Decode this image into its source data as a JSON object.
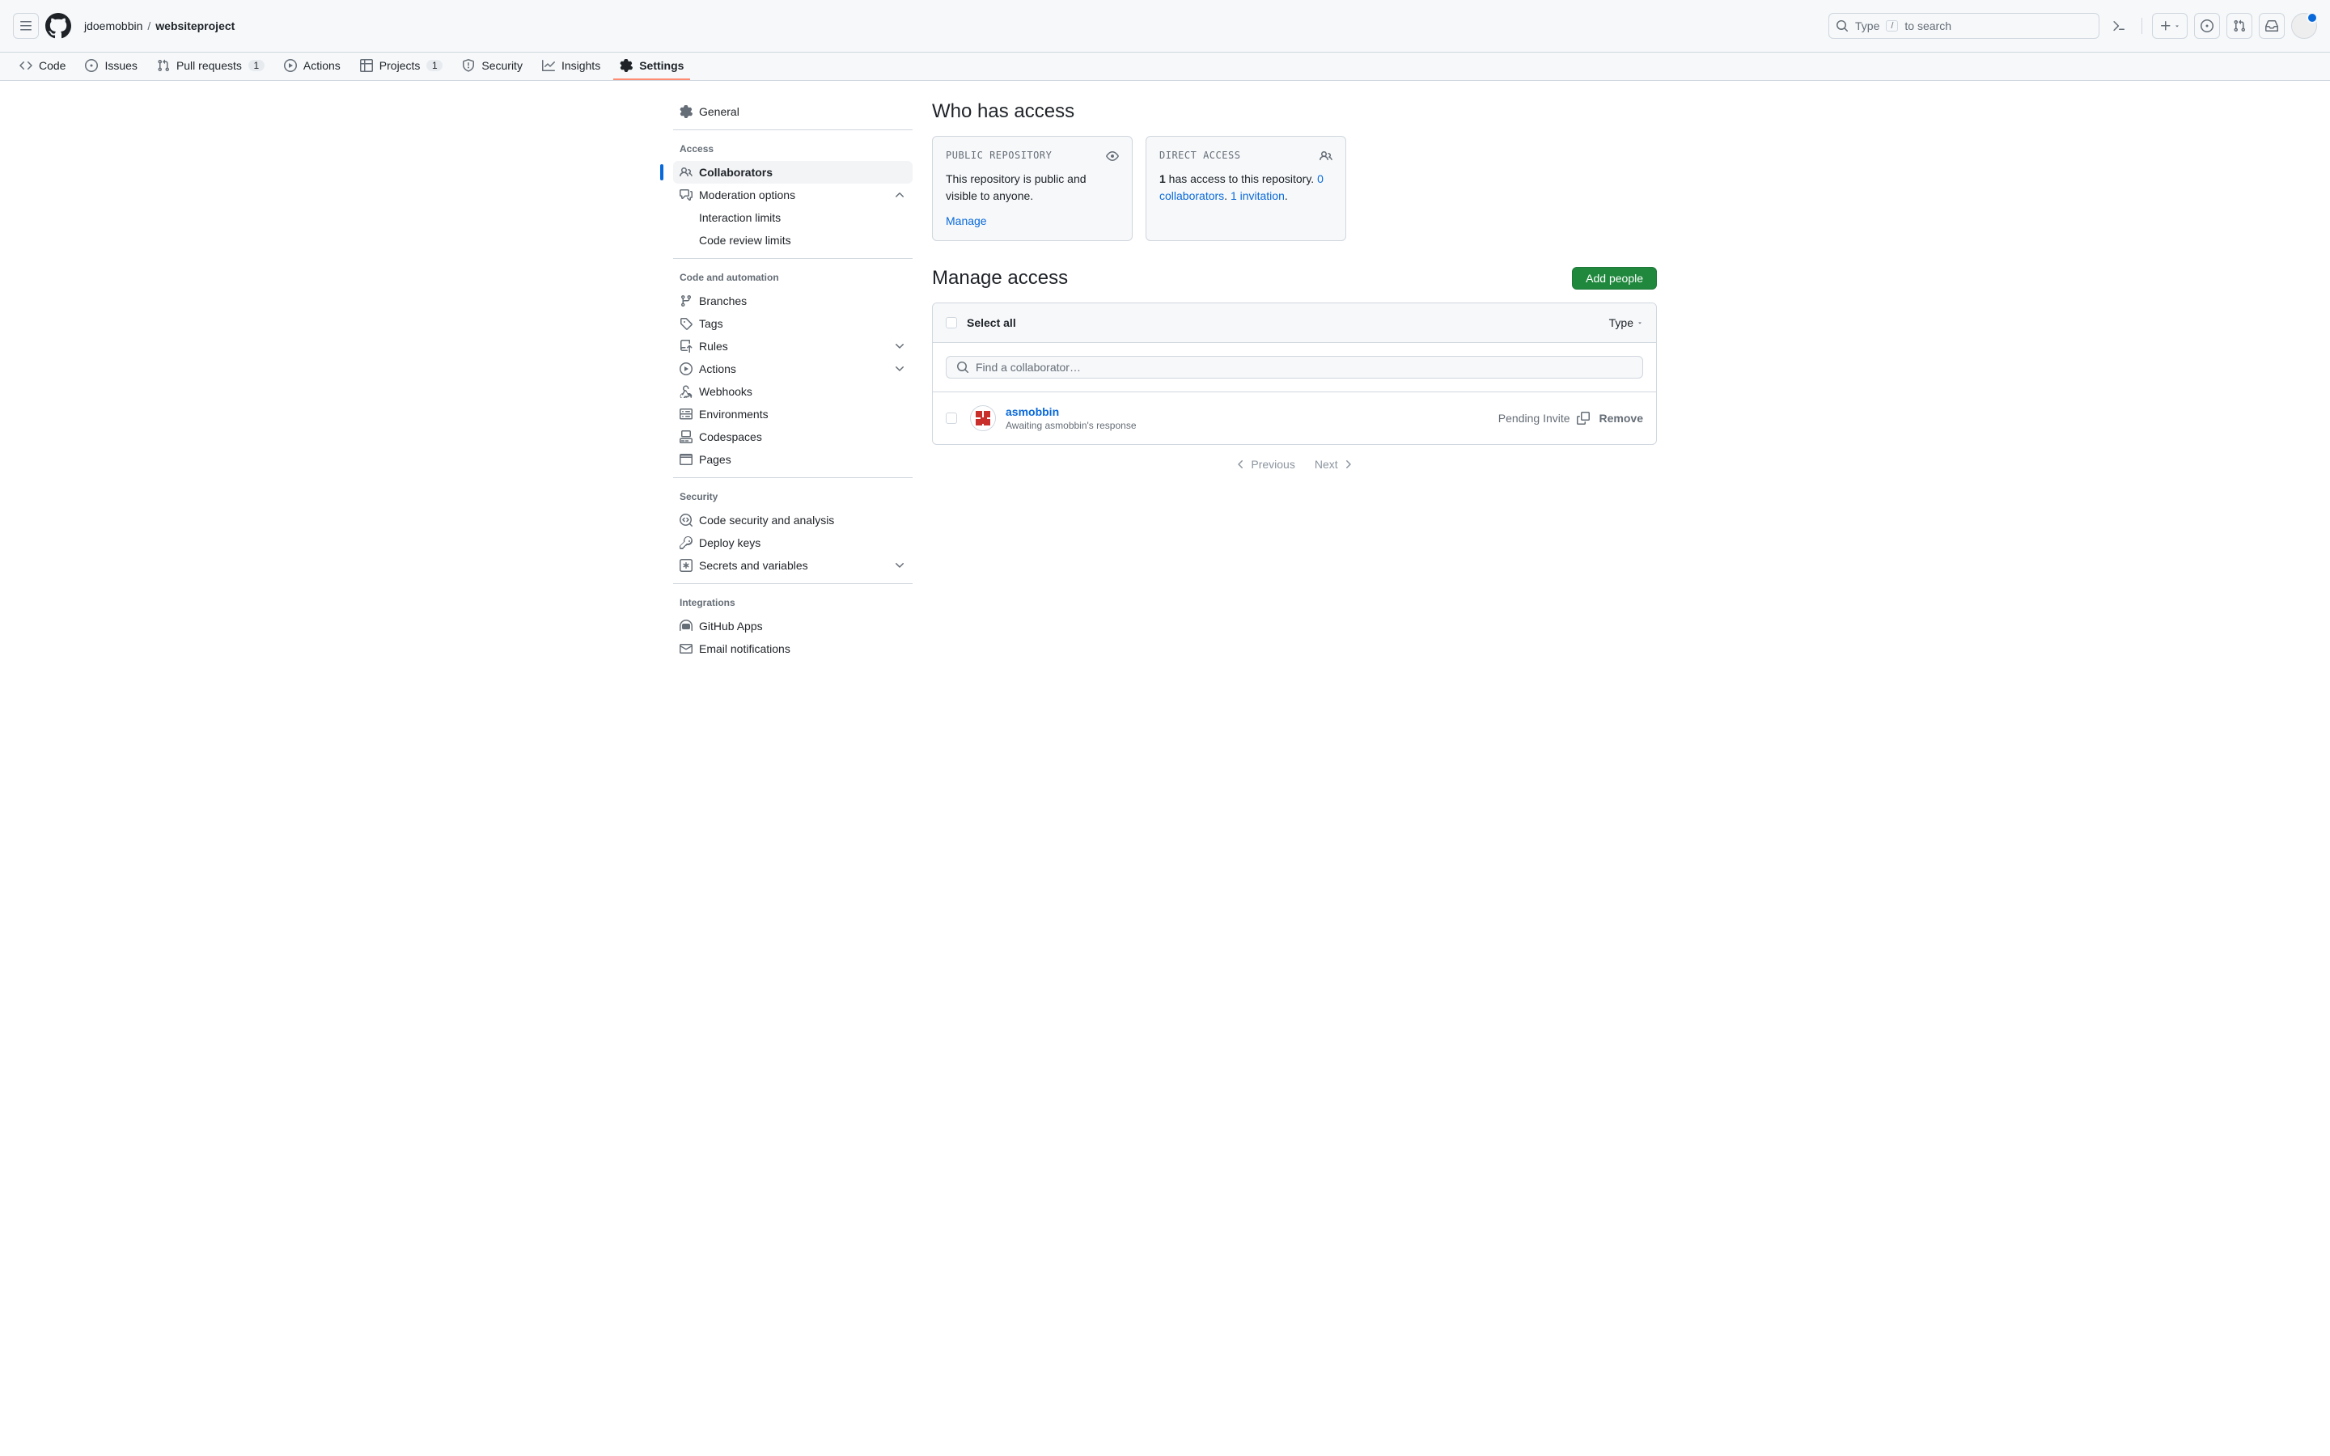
{
  "header": {
    "owner": "jdoemobbin",
    "sep": "/",
    "repo": "websiteproject",
    "search_hint_type": "Type",
    "search_hint_slash": "/",
    "search_hint_rest": "to search"
  },
  "nav": {
    "code": "Code",
    "issues": "Issues",
    "pulls": "Pull requests",
    "pulls_count": "1",
    "actions": "Actions",
    "projects": "Projects",
    "projects_count": "1",
    "security": "Security",
    "insights": "Insights",
    "settings": "Settings"
  },
  "sidebar": {
    "general": "General",
    "access_header": "Access",
    "collaborators": "Collaborators",
    "moderation": "Moderation options",
    "interaction_limits": "Interaction limits",
    "code_review_limits": "Code review limits",
    "code_auto_header": "Code and automation",
    "branches": "Branches",
    "tags": "Tags",
    "rules": "Rules",
    "actions": "Actions",
    "webhooks": "Webhooks",
    "environments": "Environments",
    "codespaces": "Codespaces",
    "pages": "Pages",
    "security_header": "Security",
    "code_security": "Code security and analysis",
    "deploy_keys": "Deploy keys",
    "secrets": "Secrets and variables",
    "integrations_header": "Integrations",
    "github_apps": "GitHub Apps",
    "email_notifications": "Email notifications"
  },
  "main": {
    "who_has_access": "Who has access",
    "public_repo_label": "PUBLIC REPOSITORY",
    "public_repo_text": "This repository is public and visible to anyone.",
    "public_repo_manage": "Manage",
    "direct_access_label": "DIRECT ACCESS",
    "direct_access_count": "1",
    "direct_access_text": " has access to this repository. ",
    "direct_access_collab_link": "0 collaborators",
    "direct_access_period1": ". ",
    "direct_access_invite_link": "1 invitation",
    "direct_access_period2": ".",
    "manage_access": "Manage access",
    "add_people": "Add people",
    "select_all": "Select all",
    "type_filter": "Type",
    "search_placeholder": "Find a collaborator…",
    "collaborator": {
      "username": "asmobbin",
      "status": "Awaiting asmobbin's response",
      "pending": "Pending Invite",
      "remove": "Remove"
    },
    "previous": "Previous",
    "next": "Next"
  }
}
